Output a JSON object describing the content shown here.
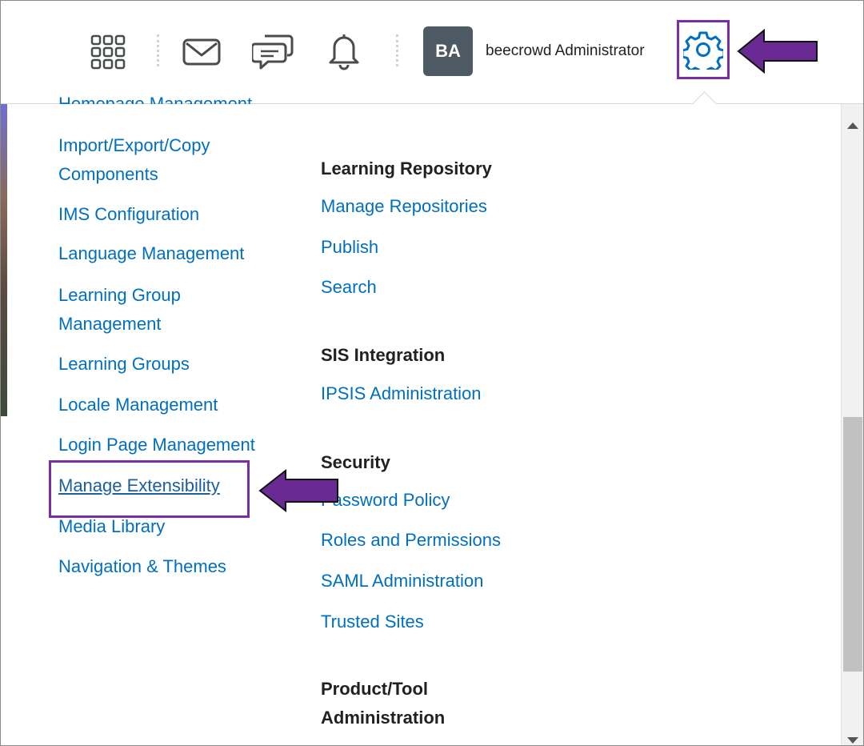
{
  "navbar": {
    "avatar_initials": "BA",
    "user_name": "beecrowd Administrator",
    "icons": [
      "waffle-grid-icon",
      "email-icon",
      "message-alerts-icon",
      "notification-bell-icon",
      "gear-icon"
    ]
  },
  "menu": {
    "left_column": {
      "clipped_item": "Homepage Management",
      "items": [
        [
          "Import/Export/Copy",
          "Components"
        ],
        [
          "IMS Configuration"
        ],
        [
          "Language Management"
        ],
        [
          "Learning Group",
          "Management"
        ],
        [
          "Learning Groups"
        ],
        [
          "Locale Management"
        ],
        [
          "Login Page Management"
        ],
        [
          "Manage Extensibility"
        ],
        [
          "Media Library"
        ],
        [
          "Navigation & Themes"
        ]
      ]
    },
    "right_column": {
      "sections": [
        {
          "heading": [
            "Learning Repository"
          ],
          "items": [
            "Manage Repositories",
            "Publish",
            "Search"
          ]
        },
        {
          "heading": [
            "SIS Integration"
          ],
          "items": [
            "IPSIS Administration"
          ]
        },
        {
          "heading": [
            "Security"
          ],
          "items": [
            "Password Policy",
            "Roles and Permissions",
            "SAML Administration",
            "Trusted Sites"
          ]
        },
        {
          "heading": [
            "Product/Tool",
            "Administration"
          ],
          "items": []
        }
      ]
    }
  },
  "colors": {
    "link": "#006fbf",
    "annotation": "#7a2ea6",
    "heading": "#202122",
    "avatar_bg": "#4d5963"
  }
}
